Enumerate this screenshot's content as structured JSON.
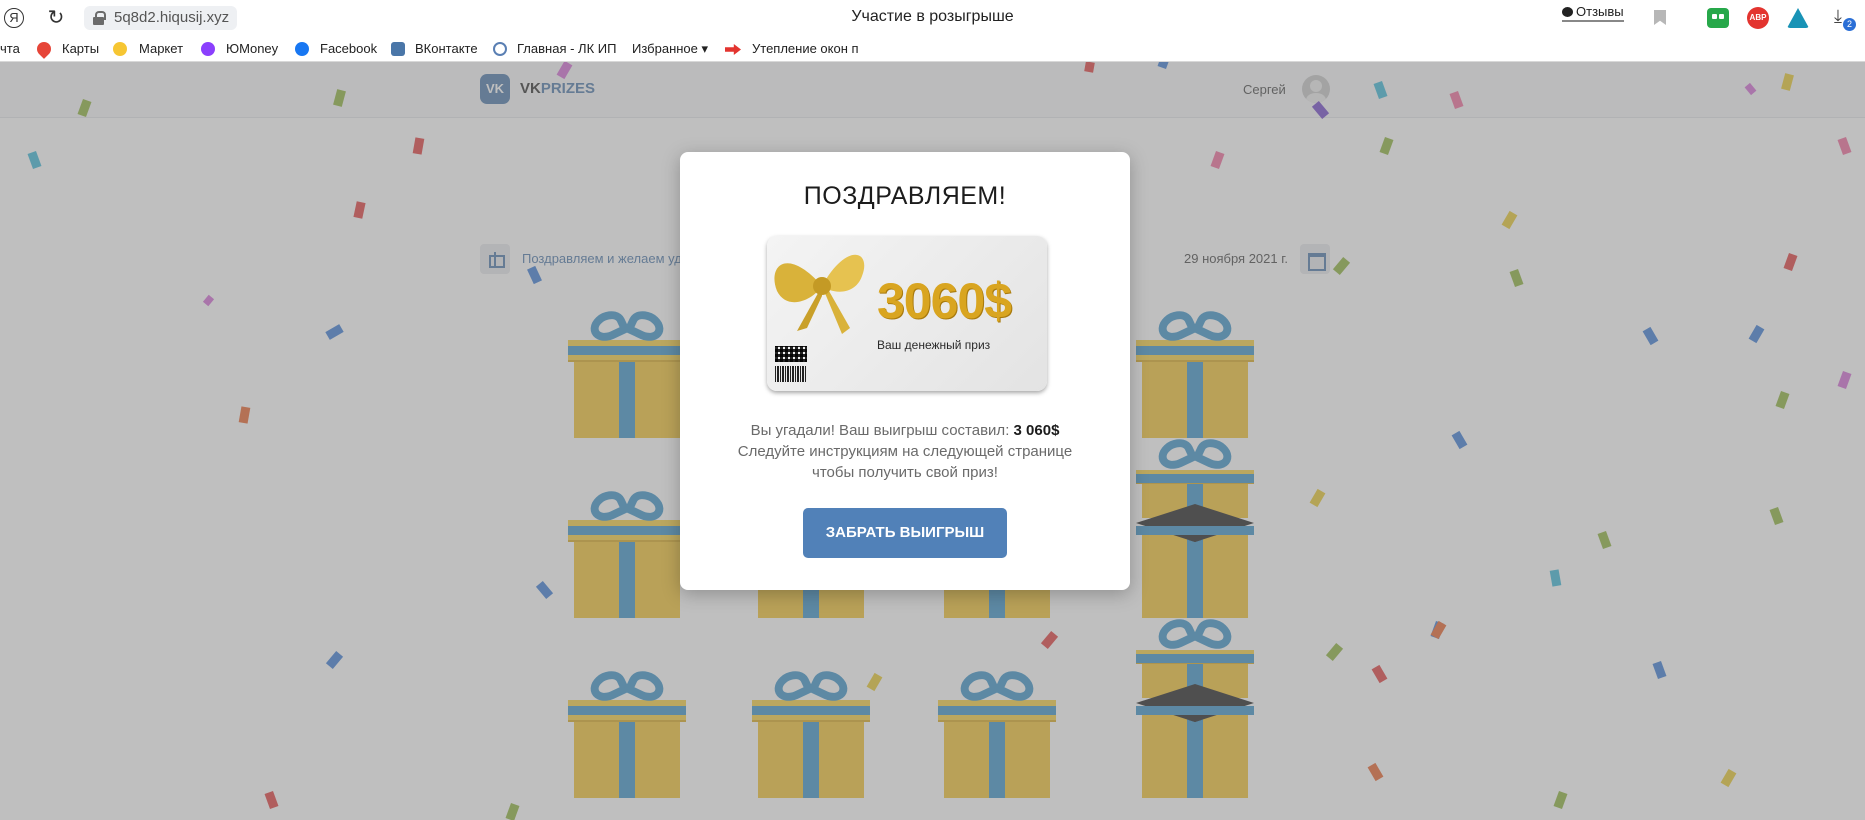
{
  "browser": {
    "yandex_icon": "Я",
    "url": "5q8d2.hiqusij.xyz",
    "tab_title": "Участие в розыгрыше",
    "reviews_label": "Отзывы",
    "downloads_count": "2",
    "abp_label": "ABP"
  },
  "bookmarks": [
    {
      "label": "чта"
    },
    {
      "label": "Карты"
    },
    {
      "label": "Маркет"
    },
    {
      "label": "ЮMoney"
    },
    {
      "label": "Facebook"
    },
    {
      "label": "ВКонтакте"
    },
    {
      "label": "Главная - ЛК ИП"
    },
    {
      "label": "Избранное ▾"
    },
    {
      "label": "Утепление окон п"
    }
  ],
  "site": {
    "logo_letters": "VK",
    "brand_part1": "VK",
    "brand_part2": "PRIZES",
    "user_name": "Сергей",
    "promo_text": "Поздравляем и желаем уд",
    "date": "29 ноября 2021 г."
  },
  "modal": {
    "heading": "ПОЗДРАВЛЯЕМ!",
    "card_amount": "3060$",
    "card_caption": "Ваш денежный приз",
    "message_before": "Вы угадали! Ваш выигрыш составил: ",
    "message_amount": "3 060$",
    "message_after": " Следуйте инструкциям на следующей странице чтобы получить свой приз!",
    "button_label": "ЗАБРАТЬ ВЫИГРЫШ"
  },
  "colors": {
    "vk_blue": "#4a76a8",
    "button_blue": "#5181b8",
    "gold": "#d9a520",
    "gift_yellow": "#f2c230",
    "ribbon_blue": "#3b93c9"
  }
}
